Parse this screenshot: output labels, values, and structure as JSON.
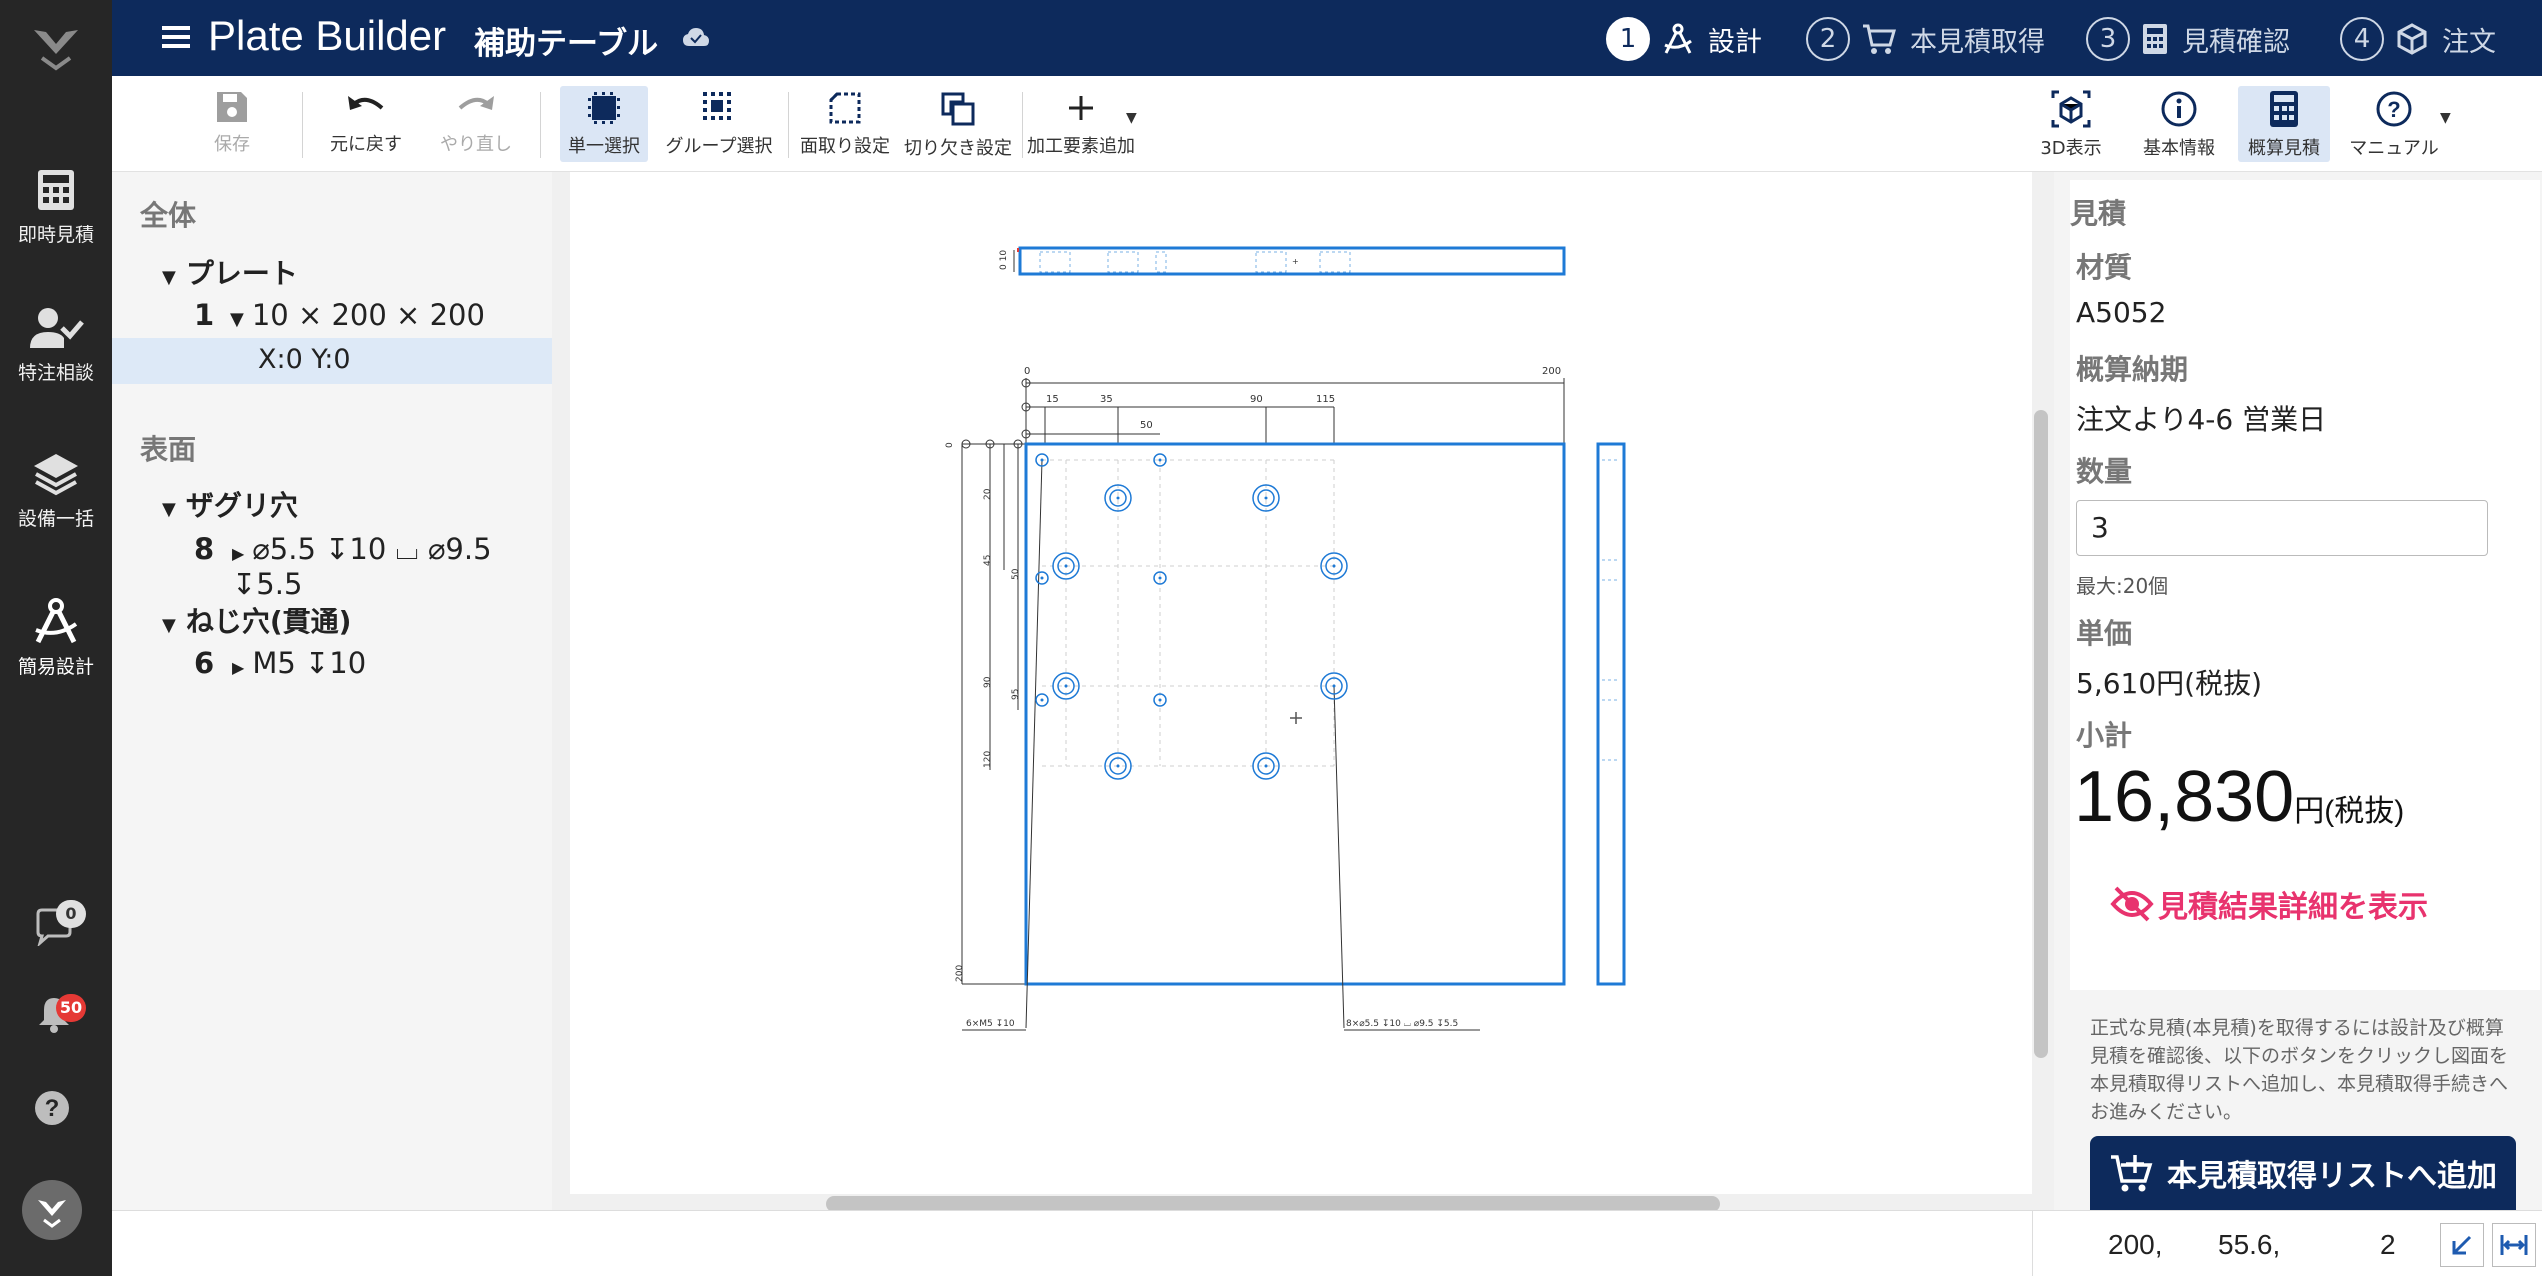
{
  "rail": {
    "items": [
      {
        "label": "即時見積",
        "icon": "calculator-icon"
      },
      {
        "label": "特注相談",
        "icon": "person-check-icon"
      },
      {
        "label": "設備一括",
        "icon": "layers-icon"
      },
      {
        "label": "簡易設計",
        "icon": "compass-icon"
      }
    ],
    "chat_count": "0",
    "notification_count": "50"
  },
  "header": {
    "app_title": "Plate Builder",
    "doc_title": "補助テーブル",
    "steps": [
      {
        "num": "1",
        "label": "設計",
        "active": true
      },
      {
        "num": "2",
        "label": "本見積取得",
        "active": false
      },
      {
        "num": "3",
        "label": "見積確認",
        "active": false
      },
      {
        "num": "4",
        "label": "注文",
        "active": false
      }
    ]
  },
  "toolbar": {
    "save": "保存",
    "undo": "元に戻す",
    "redo": "やり直し",
    "single_select": "単一選択",
    "group_select": "グループ選択",
    "chamfer": "面取り設定",
    "notch": "切り欠き設定",
    "add_feature": "加工要素追加",
    "view_3d": "3D表示",
    "basic_info": "基本情報",
    "estimate": "概算見積",
    "manual": "マニュアル"
  },
  "tree": {
    "all_header": "全体",
    "plate_group": "プレート",
    "plate_count": "1",
    "plate_dims": "10 × 200 × 200",
    "plate_pos": "X:0 Y:0",
    "surface_header": "表面",
    "counterbore_group": "ザグリ穴",
    "counterbore_count": "8",
    "counterbore_spec": "⌀5.5 ↧10 ⌴ ⌀9.5 ↧5.5",
    "tap_group": "ねじ穴(貫通)",
    "tap_count": "6",
    "tap_spec": "M5 ↧10"
  },
  "drawing": {
    "top_dims": [
      "0",
      "200"
    ],
    "hole_x_dims": [
      "15",
      "35",
      "90",
      "115"
    ],
    "hole_x_dim2": "50",
    "left_dims": [
      "0",
      "20",
      "45",
      "50",
      "90",
      "95",
      "120",
      "200"
    ],
    "tap_note": "6×M5 ↧10",
    "cbore_note": "8×⌀5.5 ↧10 ⌴ ⌀9.5 ↧5.5"
  },
  "estimate_panel": {
    "title": "見積",
    "material_label": "材質",
    "material": "A5052",
    "leadtime_label": "概算納期",
    "leadtime": "注文より4-6 営業日",
    "qty_label": "数量",
    "qty": "3",
    "qty_max": "最大:20個",
    "unit_price_label": "単価",
    "unit_price": "5,610円(税抜)",
    "subtotal_label": "小計",
    "subtotal": "16,830",
    "subtotal_unit": "円(税抜)",
    "detail_link": "見積結果詳細を表示",
    "note": "正式な見積(本見積)を取得するには設計及び概算見積を確認後、以下のボタンをクリックし図面を本見積取得リストへ追加し、本見積取得手続きへお進みください。",
    "add_button": "本見積取得リストへ追加"
  },
  "status": {
    "x": "200,",
    "y": "55.6,",
    "z": "2"
  },
  "colors": {
    "header_bg": "#0d2a5c",
    "rail_bg": "#262626",
    "accent_pink": "#e8336e",
    "drawing_blue": "#1e7ad6"
  }
}
